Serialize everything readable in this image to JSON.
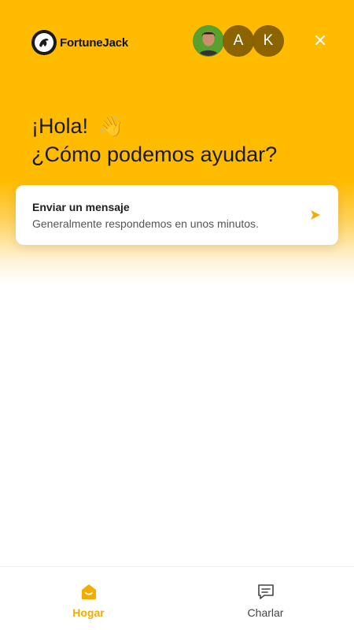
{
  "brand": {
    "name": "FortuneJack",
    "accent": "#ffbb00"
  },
  "header": {
    "avatars": [
      {
        "type": "photo",
        "icon": "person-photo"
      },
      {
        "type": "letter",
        "letter": "A"
      },
      {
        "type": "letter",
        "letter": "K"
      }
    ],
    "close_icon": "close-icon"
  },
  "greeting": {
    "line1": "¡Hola!",
    "emoji": "👋",
    "line2": "¿Cómo podemos ayudar?"
  },
  "message_card": {
    "title": "Enviar un mensaje",
    "subtitle": "Generalmente respondemos en unos minutos.",
    "icon": "send-arrow-icon"
  },
  "tabs": [
    {
      "label": "Hogar",
      "icon": "home-icon",
      "active": true
    },
    {
      "label": "Charlar",
      "icon": "chat-icon",
      "active": false
    }
  ]
}
